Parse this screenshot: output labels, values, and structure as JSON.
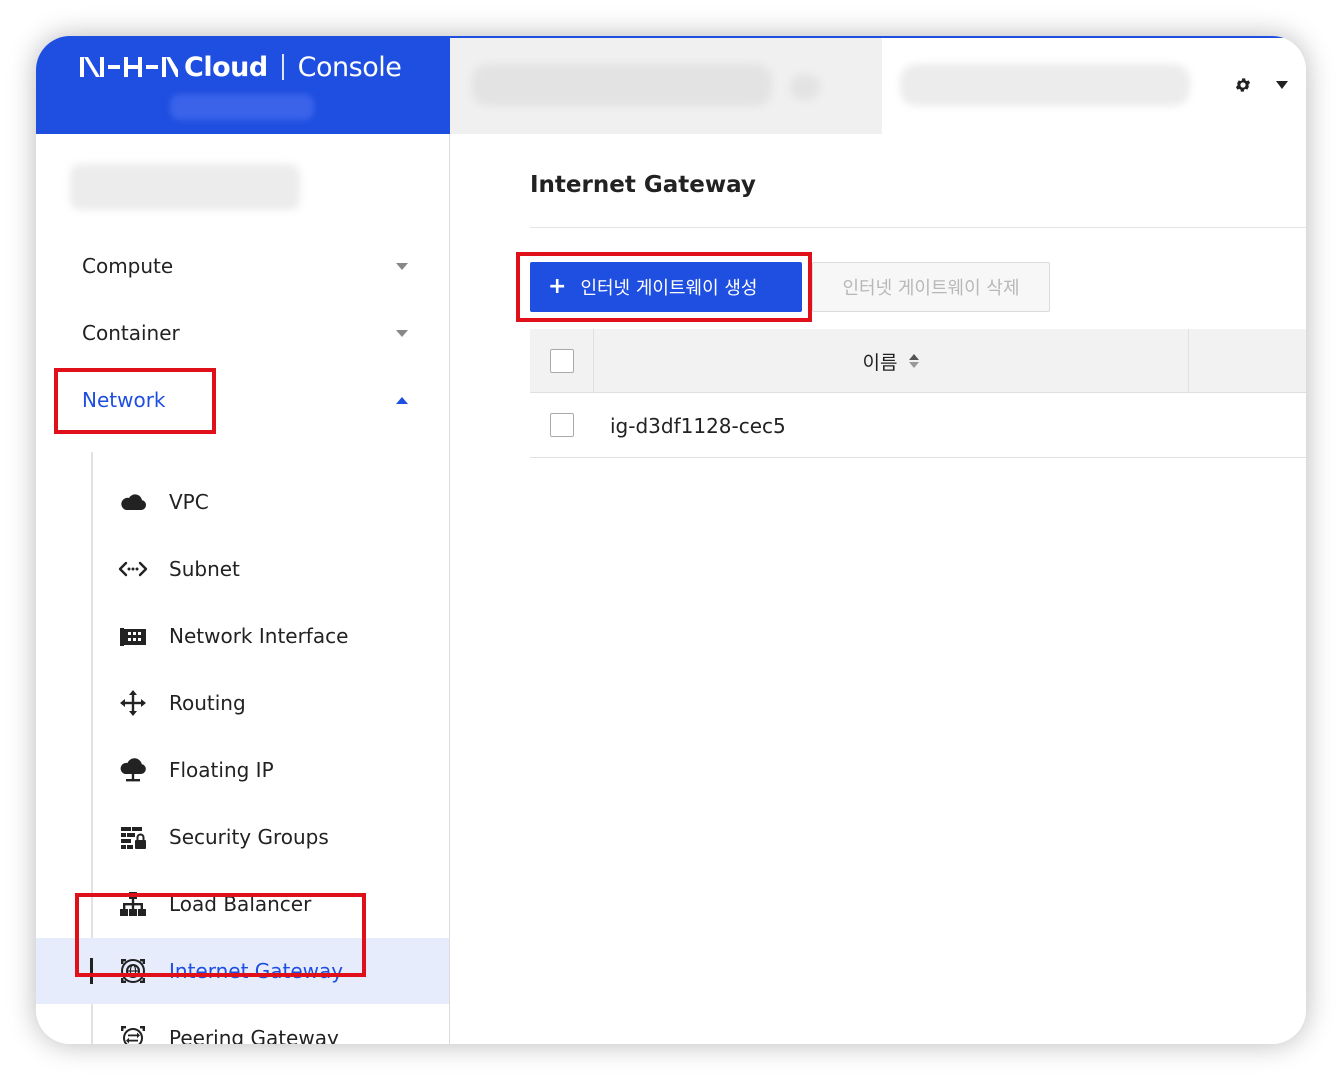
{
  "brand": {
    "cloud": "Cloud",
    "console": "Console"
  },
  "sidebar": {
    "categories": [
      {
        "label": "Compute",
        "expanded": false
      },
      {
        "label": "Container",
        "expanded": false
      },
      {
        "label": "Network",
        "expanded": true
      }
    ],
    "network_items": [
      {
        "label": "VPC",
        "icon": "cloud-icon"
      },
      {
        "label": "Subnet",
        "icon": "subnet-arrows-icon"
      },
      {
        "label": "Network Interface",
        "icon": "network-card-icon"
      },
      {
        "label": "Routing",
        "icon": "routing-arrows-icon"
      },
      {
        "label": "Floating IP",
        "icon": "floating-ip-cloud-icon"
      },
      {
        "label": "Security Groups",
        "icon": "firewall-lock-icon"
      },
      {
        "label": "Load Balancer",
        "icon": "sitemap-icon"
      },
      {
        "label": "Internet Gateway",
        "icon": "internet-gateway-icon",
        "selected": true
      },
      {
        "label": "Peering Gateway",
        "icon": "peering-gateway-icon"
      }
    ]
  },
  "main": {
    "title": "Internet Gateway",
    "create_button": "인터넷 게이트웨이 생성",
    "create_icon": "+",
    "delete_button": "인터넷 게이트웨이 삭제",
    "table": {
      "columns": [
        "이름"
      ],
      "rows": [
        {
          "name": "ig-d3df1128-cec5"
        }
      ]
    }
  },
  "colors": {
    "brand_blue": "#1f4fe0",
    "highlight_red": "#e0101a",
    "selected_bg": "#e6ecfb"
  }
}
